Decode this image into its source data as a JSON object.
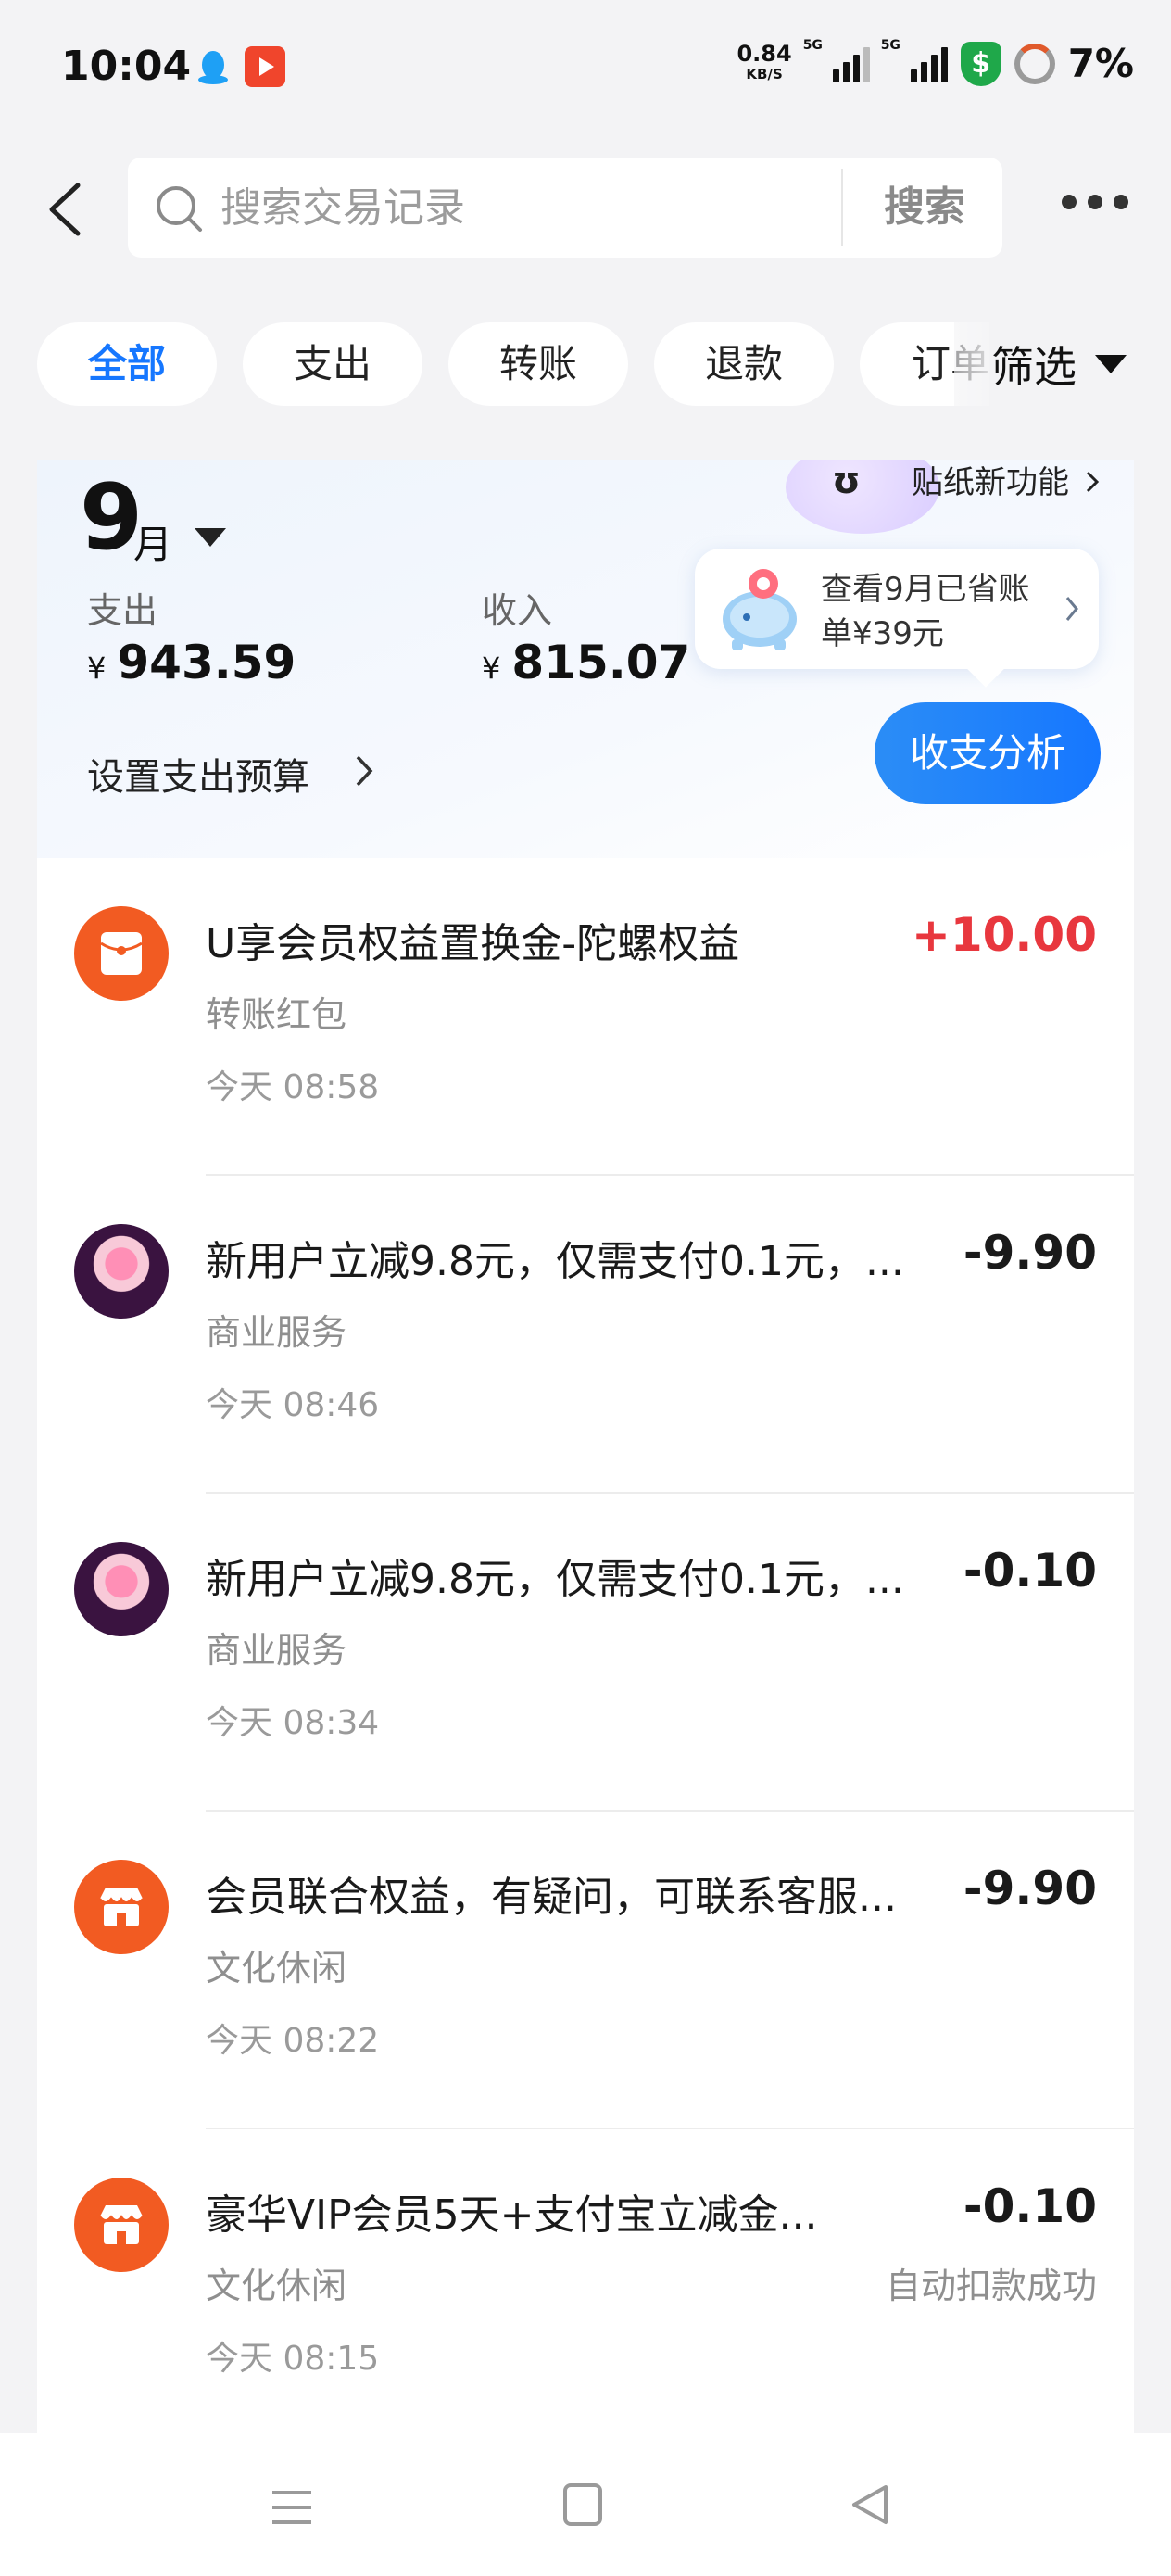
{
  "status_bar": {
    "time": "10:04",
    "net_speed": "0.84",
    "net_unit": "KB/S",
    "sim1": "5G",
    "sim2": "5G",
    "battery": "7%",
    "icons": [
      "qq-icon",
      "video-app-icon",
      "signal-icon",
      "signal-icon",
      "security-shield-icon",
      "battery-ring-icon"
    ]
  },
  "header": {
    "search_placeholder": "搜索交易记录",
    "search_button": "搜索"
  },
  "filters": {
    "chips": [
      "全部",
      "支出",
      "转账",
      "退款",
      "订单"
    ],
    "active_index": 0,
    "filter_label": "筛选"
  },
  "summary": {
    "month": "9",
    "month_unit": "月",
    "sticker_link": "贴纸新功能",
    "expense_label": "支出",
    "expense_value": "943.59",
    "income_label": "收入",
    "income_value": "815.07",
    "currency": "¥",
    "budget_link": "设置支出预算",
    "save_tip": "查看9月已省账单¥39元",
    "analyze_button": "收支分析"
  },
  "transactions": [
    {
      "title": "U享会员权益置换金-陀螺权益",
      "category": "转账红包",
      "time": "今天 08:58",
      "amount": "+10.00",
      "positive": true,
      "icon": "red-packet-icon",
      "status": ""
    },
    {
      "title": "新用户立减9.8元，仅需支付0.1元，...",
      "category": "商业服务",
      "time": "今天 08:46",
      "amount": "-9.90",
      "positive": false,
      "icon": "lollipop-logo-icon",
      "status": ""
    },
    {
      "title": "新用户立减9.8元，仅需支付0.1元，...",
      "category": "商业服务",
      "time": "今天 08:34",
      "amount": "-0.10",
      "positive": false,
      "icon": "lollipop-logo-icon",
      "status": ""
    },
    {
      "title": "会员联合权益，有疑问，可联系客服...",
      "category": "文化休闲",
      "time": "今天 08:22",
      "amount": "-9.90",
      "positive": false,
      "icon": "store-icon",
      "status": ""
    },
    {
      "title": "豪华VIP会员5天+支付宝立减金...",
      "category": "文化休闲",
      "time": "今天 08:15",
      "amount": "-0.10",
      "positive": false,
      "icon": "store-icon",
      "status": "自动扣款成功"
    }
  ],
  "colors": {
    "accent": "#1677ff",
    "positive_amount": "#e8373e",
    "merchant_orange": "#f25b22"
  }
}
